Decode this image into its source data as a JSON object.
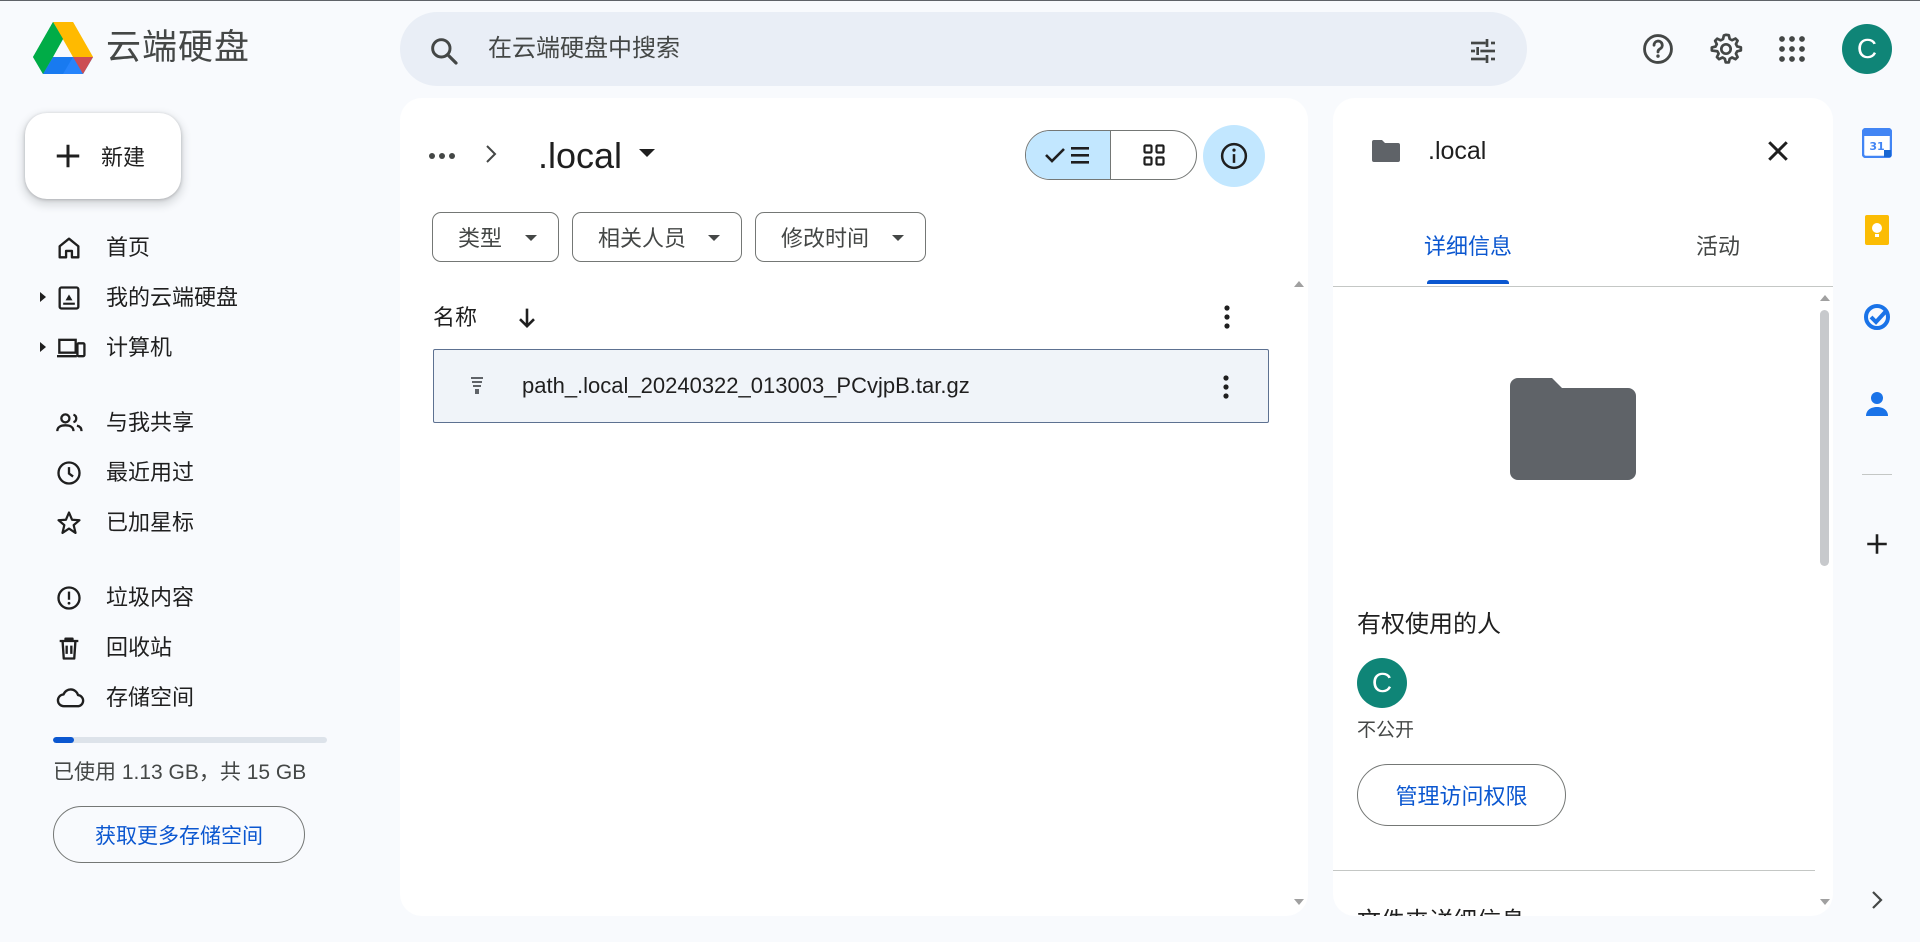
{
  "app": {
    "title": "云端硬盘"
  },
  "search": {
    "placeholder": "在云端硬盘中搜索"
  },
  "header": {
    "avatar_letter": "C"
  },
  "sidebar": {
    "new_label": "新建",
    "items": [
      {
        "label": "首页",
        "icon": "home-icon"
      },
      {
        "label": "我的云端硬盘",
        "icon": "drive-icon"
      },
      {
        "label": "计算机",
        "icon": "computer-icon"
      },
      {
        "label": "与我共享",
        "icon": "people-icon"
      },
      {
        "label": "最近用过",
        "icon": "clock-icon"
      },
      {
        "label": "已加星标",
        "icon": "star-icon"
      },
      {
        "label": "垃圾内容",
        "icon": "spam-icon"
      },
      {
        "label": "回收站",
        "icon": "trash-icon"
      },
      {
        "label": "存储空间",
        "icon": "cloud-icon"
      }
    ],
    "storage": {
      "used_fraction": 0.075,
      "text": "已使用 1.13 GB，共 15 GB",
      "get_more_label": "获取更多存储空间"
    }
  },
  "main": {
    "breadcrumb_current": ".local",
    "filters": [
      "类型",
      "相关人员",
      "修改时间"
    ],
    "list_header": {
      "name": "名称"
    },
    "files": [
      {
        "name": "path_.local_20240322_013003_PCvjpB.tar.gz"
      }
    ]
  },
  "details": {
    "title": ".local",
    "tabs": [
      "详细信息",
      "活动"
    ],
    "access_title": "有权使用的人",
    "access_avatar_letter": "C",
    "access_status": "不公开",
    "manage_label": "管理访问权限",
    "next_section": "文件夹详细信息"
  },
  "colors": {
    "accent": "#0b57d0",
    "selected_bg": "#c2e7ff",
    "avatar": "#0f8577",
    "folder": "#5f6368"
  }
}
